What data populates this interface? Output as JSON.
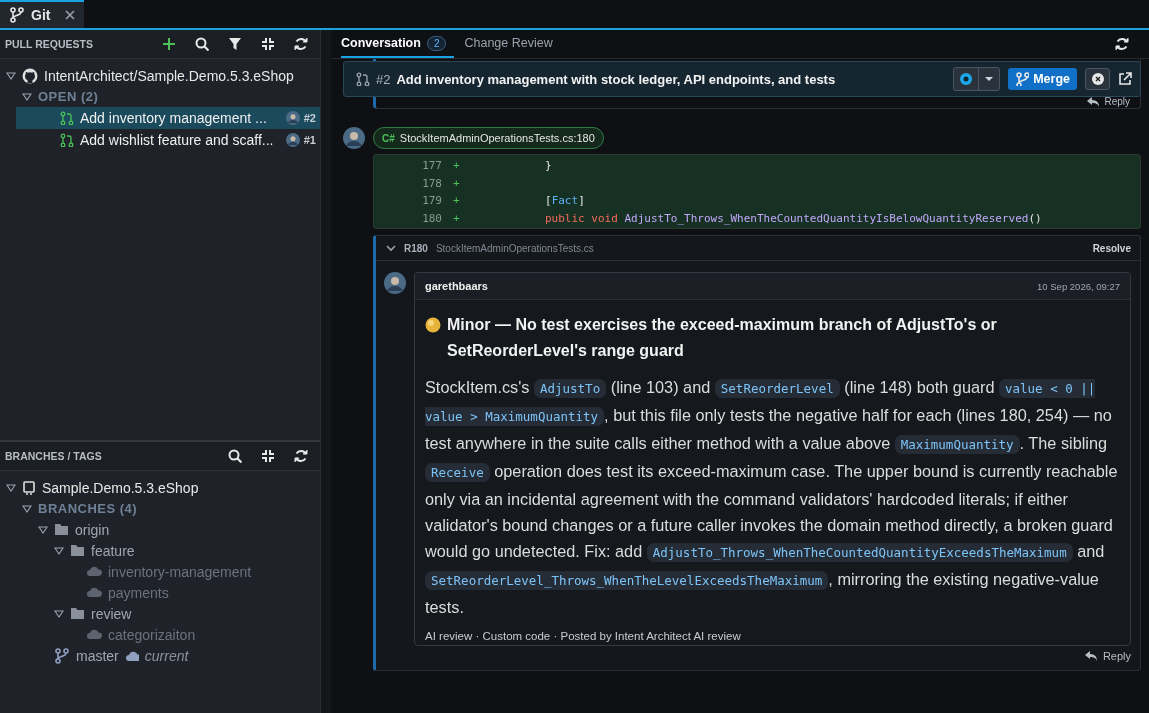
{
  "tab": {
    "label": "Git",
    "selected": true
  },
  "pull_requests": {
    "title": "PULL REQUESTS",
    "tree": [
      {
        "kind": "repo",
        "label": "IntentArchitect/Sample.Demo.5.3.eShop",
        "expanded": true,
        "children": [
          {
            "kind": "group",
            "label": "OPEN (2)",
            "expanded": true,
            "children": [
              {
                "kind": "pr",
                "label": "Add inventory management ...",
                "number": "#2",
                "selected": true
              },
              {
                "kind": "pr",
                "label": "Add wishlist feature and scaff...",
                "number": "#1",
                "selected": false
              }
            ]
          }
        ]
      }
    ]
  },
  "branches": {
    "title": "BRANCHES / TAGS",
    "tree": [
      {
        "kind": "local-repo",
        "label": "Sample.Demo.5.3.eShop",
        "expanded": true,
        "children": [
          {
            "kind": "group",
            "label": "BRANCHES (4)",
            "expanded": true,
            "children": [
              {
                "kind": "folder",
                "label": "origin",
                "expanded": true,
                "children": [
                  {
                    "kind": "folder",
                    "label": "feature",
                    "expanded": true,
                    "children": [
                      {
                        "kind": "remote",
                        "label": "inventory-management"
                      },
                      {
                        "kind": "remote",
                        "label": "payments"
                      }
                    ]
                  },
                  {
                    "kind": "folder",
                    "label": "review",
                    "expanded": true,
                    "children": [
                      {
                        "kind": "remote",
                        "label": "categorizaiton"
                      }
                    ]
                  }
                ]
              },
              {
                "kind": "branch",
                "label": "master",
                "note": "current"
              }
            ]
          }
        ]
      }
    ]
  },
  "detail": {
    "tabs": [
      {
        "label": "Conversation",
        "count": "2",
        "selected": true
      },
      {
        "label": "Change Review",
        "selected": false
      }
    ],
    "pr": {
      "number": "#2",
      "title": "Add inventory management with stock ledger, API endpoints, and tests",
      "merge": "Merge"
    },
    "previous_reply": "Reply",
    "comment": {
      "language": "C#",
      "file": "StockItemAdminOperationsTests.cs:180",
      "diff": [
        {
          "line": "177",
          "sign": "+",
          "code": [
            {
              "kind": "plain",
              "text": "}"
            }
          ]
        },
        {
          "line": "178",
          "sign": "+"
        },
        {
          "line": "179",
          "sign": "+",
          "code": [
            {
              "kind": "plain",
              "text": "["
            },
            {
              "kind": "type",
              "text": "Fact"
            },
            {
              "kind": "plain",
              "text": "]"
            }
          ]
        },
        {
          "line": "180",
          "sign": "+",
          "code": [
            {
              "kind": "keyword",
              "text": "public"
            },
            {
              "kind": "keyword",
              "text": "void"
            },
            {
              "kind": "method",
              "text": "AdjustTo_Throws_WhenTheCountedQuantityIsBelowQuantityReserved"
            },
            {
              "kind": "plain",
              "text": "()"
            }
          ]
        }
      ],
      "thread": {
        "expanded": true,
        "line": "R180",
        "file": "StockItemAdminOperationsTests.cs",
        "resolve": "Resolve",
        "author": "garethbaars",
        "date": "10 Sep 2026, 09:27",
        "title": "Minor — No test exercises the exceed-maximum branch of AdjustTo's or SetReorderLevel's range guard",
        "body": [
          {
            "kind": "text",
            "text": "StockItem.cs's "
          },
          {
            "kind": "code",
            "text": "AdjustTo"
          },
          {
            "kind": "text",
            "text": " (line 103) and "
          },
          {
            "kind": "code",
            "text": "SetReorderLevel"
          },
          {
            "kind": "text",
            "text": " (line 148) both guard "
          },
          {
            "kind": "code",
            "text": "value < 0 || value > MaximumQuantity"
          },
          {
            "kind": "text",
            "text": ", but this file only tests the negative half for each (lines 180, 254) — no test anywhere in the suite calls either method with a value above "
          },
          {
            "kind": "code",
            "text": "MaximumQuantity"
          },
          {
            "kind": "text",
            "text": ". The sibling "
          },
          {
            "kind": "code",
            "text": "Receive"
          },
          {
            "kind": "text",
            "text": " operation does test its exceed-maximum case. The upper bound is currently reachable only via an incidental agreement with the command validators' hardcoded literals; if either validator's bound changes or a future caller invokes the domain method directly, a broken guard would go undetected. Fix: add "
          },
          {
            "kind": "code",
            "text": "AdjustTo_Throws_WhenTheCountedQuantityExceedsTheMaximum"
          },
          {
            "kind": "text",
            "text": " and "
          },
          {
            "kind": "code",
            "text": "SetReorderLevel_Throws_WhenTheLevelExceedsTheMaximum"
          },
          {
            "kind": "text",
            "text": ", mirroring the existing negative-value tests."
          }
        ],
        "footer": "AI review · Custom code · Posted by Intent Architect AI review",
        "reply": "Reply"
      }
    }
  }
}
